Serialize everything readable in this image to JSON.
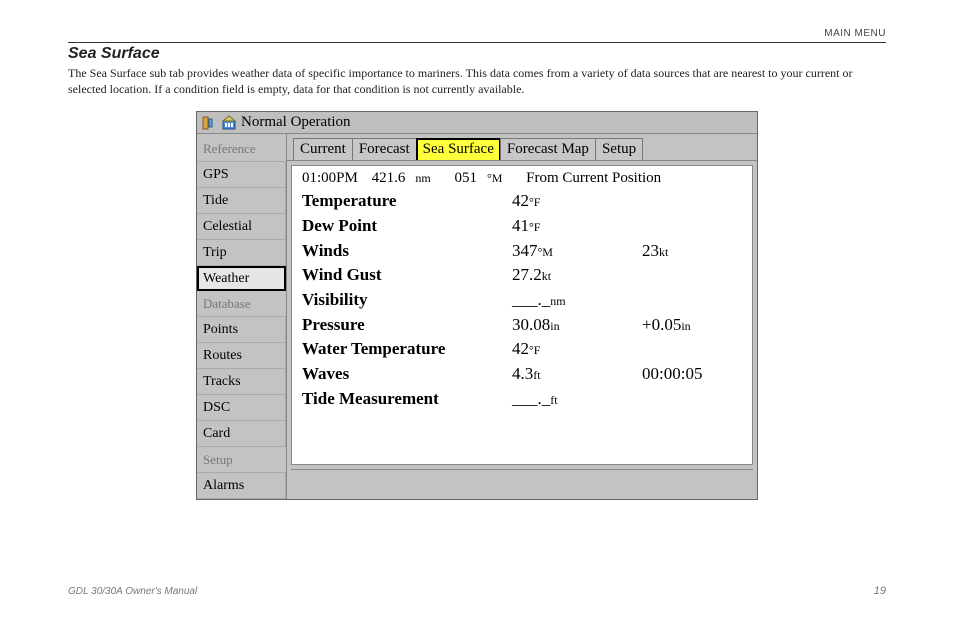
{
  "page": {
    "header_right": "MAIN MENU",
    "section_title": "Sea Surface",
    "body_text": "The Sea Surface sub tab provides weather data of specific importance to mariners. This data comes from a variety of data sources that are nearest to your current or selected location. If a condition field is empty, data for that condition is not currently available.",
    "footer_left": "GDL 30/30A Owner's Manual",
    "footer_right": "19"
  },
  "device": {
    "title": "Normal Operation",
    "sidebar": {
      "group1_label": "Reference",
      "group1": [
        "GPS",
        "Tide",
        "Celestial",
        "Trip",
        "Weather"
      ],
      "group1_selected": "Weather",
      "group2_label": "Database",
      "group2": [
        "Points",
        "Routes",
        "Tracks",
        "DSC",
        "Card"
      ],
      "group3_label": "Setup",
      "group3": [
        "Alarms"
      ]
    },
    "tabs": [
      "Current",
      "Forecast",
      "Sea Surface",
      "Forecast Map",
      "Setup"
    ],
    "tabs_selected": "Sea Surface",
    "meta": {
      "time": "01:00PM",
      "distance": "421.6",
      "distance_unit": "nm",
      "bearing": "051",
      "bearing_unit": "°M",
      "from": "From Current Position"
    },
    "rows": [
      {
        "label": "Temperature",
        "v1": "42",
        "u1": "°F",
        "v2": "",
        "u2": ""
      },
      {
        "label": "Dew Point",
        "v1": "41",
        "u1": "°F",
        "v2": "",
        "u2": ""
      },
      {
        "label": "Winds",
        "v1": "347",
        "u1": "°M",
        "v2": "23",
        "u2": "kt"
      },
      {
        "label": "Wind Gust",
        "v1": "27.2",
        "u1": "kt",
        "v2": "",
        "u2": ""
      },
      {
        "label": "Visibility",
        "v1": "___._",
        "u1": "nm",
        "v2": "",
        "u2": ""
      },
      {
        "label": "Pressure",
        "v1": "30.08",
        "u1": "in",
        "v2": "+0.05",
        "u2": "in"
      },
      {
        "label": "Water Temperature",
        "v1": "42",
        "u1": "°F",
        "v2": "",
        "u2": ""
      },
      {
        "label": "Waves",
        "v1": "4.3",
        "u1": "ft",
        "v2": "00:00:05",
        "u2": ""
      },
      {
        "label": "Tide Measurement",
        "v1": "___._",
        "u1": "ft",
        "v2": "",
        "u2": ""
      }
    ]
  }
}
